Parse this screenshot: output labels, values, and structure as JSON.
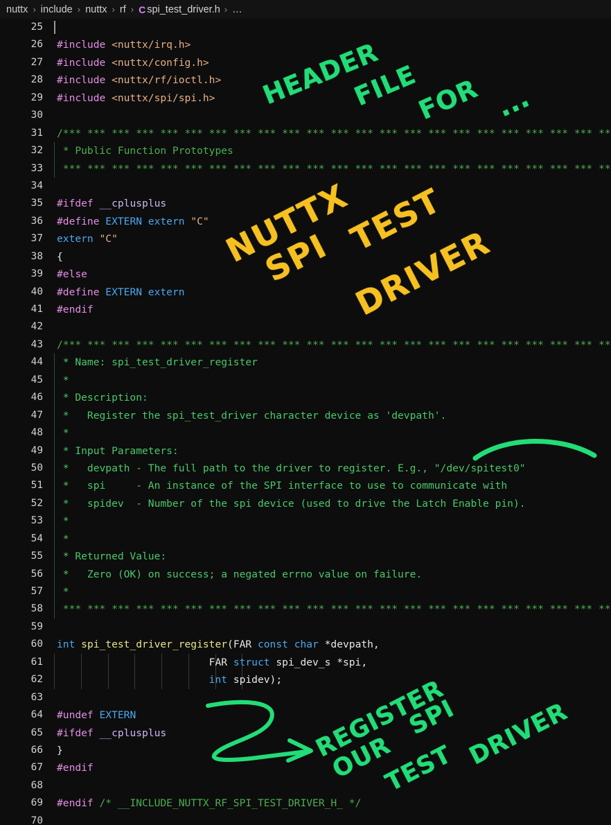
{
  "window": {
    "app": "code-editor",
    "background": "#0d0d0d"
  },
  "breadcrumb": {
    "separator": "›",
    "file_icon_label": "C",
    "items": [
      "nuttx",
      "include",
      "nuttx",
      "rf"
    ],
    "file": "spi_test_driver.h",
    "trailing": "…"
  },
  "colors": {
    "background": "#0d0d0d",
    "breadcrumb_bg": "#131313",
    "line_number": "#d2d2d2",
    "preprocessor": "#e48fe4",
    "string_path": "#e8b086",
    "comment": "#4caf50",
    "comment_body": "#49c96a",
    "identifier": "#c9b9f0",
    "keyword": "#4aa8ef",
    "function": "#e9e58a",
    "plain": "#e8e8e8",
    "annotation_green": "#22dd77",
    "annotation_yellow": "#f6c021"
  },
  "editor": {
    "first_line": 25,
    "last_line": 70,
    "comment_bar": "*** *** *** *** *** *** *** *** *** *** *** *** *** *** *** *** *** *** *** *** *** *** *** *** ***",
    "lines": [
      {
        "n": 25,
        "tokens": []
      },
      {
        "n": 26,
        "tokens": [
          {
            "t": "#include ",
            "c": "t-pre"
          },
          {
            "t": "<nuttx/irq.h>",
            "c": "t-path"
          }
        ]
      },
      {
        "n": 27,
        "tokens": [
          {
            "t": "#include ",
            "c": "t-pre"
          },
          {
            "t": "<nuttx/config.h>",
            "c": "t-path"
          }
        ]
      },
      {
        "n": 28,
        "tokens": [
          {
            "t": "#include ",
            "c": "t-pre"
          },
          {
            "t": "<nuttx/rf/ioctl.h>",
            "c": "t-path"
          }
        ]
      },
      {
        "n": 29,
        "tokens": [
          {
            "t": "#include ",
            "c": "t-pre"
          },
          {
            "t": "<nuttx/spi/spi.h>",
            "c": "t-path"
          }
        ]
      },
      {
        "n": 30,
        "tokens": []
      },
      {
        "n": 31,
        "tokens": [
          {
            "t": "/*** *** *** *** *** *** *** *** *** *** *** *** *** *** *** *** *** *** *** *** *** *** *** *** ****",
            "c": "t-com"
          }
        ]
      },
      {
        "n": 32,
        "tokens": [
          {
            "t": " * Public Function Prototypes",
            "c": "t-com"
          }
        ]
      },
      {
        "n": 33,
        "tokens": [
          {
            "t": " *** *** *** *** *** *** *** *** *** *** *** *** *** *** *** *** *** *** *** *** *** *** *** ***/",
            "c": "t-com"
          }
        ]
      },
      {
        "n": 34,
        "tokens": []
      },
      {
        "n": 35,
        "tokens": [
          {
            "t": "#ifdef ",
            "c": "t-pre"
          },
          {
            "t": "__cplusplus",
            "c": "t-id"
          }
        ]
      },
      {
        "n": 36,
        "tokens": [
          {
            "t": "#define ",
            "c": "t-pre"
          },
          {
            "t": "EXTERN extern ",
            "c": "t-kw"
          },
          {
            "t": "\"C\"",
            "c": "t-path"
          }
        ]
      },
      {
        "n": 37,
        "tokens": [
          {
            "t": "extern ",
            "c": "t-kw"
          },
          {
            "t": "\"C\"",
            "c": "t-path"
          }
        ]
      },
      {
        "n": 38,
        "tokens": [
          {
            "t": "{",
            "c": "t-pl"
          }
        ]
      },
      {
        "n": 39,
        "tokens": [
          {
            "t": "#else",
            "c": "t-pre"
          }
        ]
      },
      {
        "n": 40,
        "tokens": [
          {
            "t": "#define ",
            "c": "t-pre"
          },
          {
            "t": "EXTERN extern",
            "c": "t-kw"
          }
        ]
      },
      {
        "n": 41,
        "tokens": [
          {
            "t": "#endif",
            "c": "t-pre"
          }
        ]
      },
      {
        "n": 42,
        "tokens": []
      },
      {
        "n": 43,
        "tokens": [
          {
            "t": "/*** *** *** *** *** *** *** *** *** *** *** *** *** *** *** *** *** *** *** *** *** *** *** *** ****",
            "c": "t-com"
          }
        ]
      },
      {
        "n": 44,
        "tokens": [
          {
            "t": " * Name: spi_test_driver_register",
            "c": "t-com2"
          }
        ]
      },
      {
        "n": 45,
        "tokens": [
          {
            "t": " *",
            "c": "t-com2"
          }
        ]
      },
      {
        "n": 46,
        "tokens": [
          {
            "t": " * Description:",
            "c": "t-com2"
          }
        ]
      },
      {
        "n": 47,
        "tokens": [
          {
            "t": " *   Register the spi_test_driver character device as 'devpath'.",
            "c": "t-com2"
          }
        ]
      },
      {
        "n": 48,
        "tokens": [
          {
            "t": " *",
            "c": "t-com2"
          }
        ]
      },
      {
        "n": 49,
        "tokens": [
          {
            "t": " * Input Parameters:",
            "c": "t-com2"
          }
        ]
      },
      {
        "n": 50,
        "tokens": [
          {
            "t": " *   devpath - The full path to the driver to register. E.g., \"/dev/spitest0\"",
            "c": "t-com2"
          }
        ]
      },
      {
        "n": 51,
        "tokens": [
          {
            "t": " *   spi     - An instance of the SPI interface to use to communicate with",
            "c": "t-com2"
          }
        ]
      },
      {
        "n": 52,
        "tokens": [
          {
            "t": " *   spidev  - Number of the spi device (used to drive the Latch Enable pin).",
            "c": "t-com2"
          }
        ]
      },
      {
        "n": 53,
        "tokens": [
          {
            "t": " *",
            "c": "t-com2"
          }
        ]
      },
      {
        "n": 54,
        "tokens": [
          {
            "t": " *",
            "c": "t-com2"
          }
        ]
      },
      {
        "n": 55,
        "tokens": [
          {
            "t": " * Returned Value:",
            "c": "t-com2"
          }
        ]
      },
      {
        "n": 56,
        "tokens": [
          {
            "t": " *   Zero (OK) on success; a negated errno value on failure.",
            "c": "t-com2"
          }
        ]
      },
      {
        "n": 57,
        "tokens": [
          {
            "t": " *",
            "c": "t-com2"
          }
        ]
      },
      {
        "n": 58,
        "tokens": [
          {
            "t": " *** *** *** *** *** *** *** *** *** *** *** *** *** *** *** *** *** *** *** *** *** *** *** ***/",
            "c": "t-com"
          }
        ]
      },
      {
        "n": 59,
        "tokens": []
      },
      {
        "n": 60,
        "tokens": [
          {
            "t": "int ",
            "c": "t-kw"
          },
          {
            "t": "spi_test_driver_register",
            "c": "t-fn"
          },
          {
            "t": "(",
            "c": "t-pl"
          },
          {
            "t": "FAR ",
            "c": "t-pl"
          },
          {
            "t": "const char ",
            "c": "t-kw"
          },
          {
            "t": "*devpath,",
            "c": "t-pl"
          }
        ]
      },
      {
        "n": 61,
        "tokens": [
          {
            "t": "                         ",
            "c": "t-pl"
          },
          {
            "t": "FAR ",
            "c": "t-pl"
          },
          {
            "t": "struct ",
            "c": "t-kw"
          },
          {
            "t": "spi_dev_s *spi,",
            "c": "t-pl"
          }
        ]
      },
      {
        "n": 62,
        "tokens": [
          {
            "t": "                         ",
            "c": "t-pl"
          },
          {
            "t": "int ",
            "c": "t-kw"
          },
          {
            "t": "spidev);",
            "c": "t-pl"
          }
        ]
      },
      {
        "n": 63,
        "tokens": []
      },
      {
        "n": 64,
        "tokens": [
          {
            "t": "#undef ",
            "c": "t-pre"
          },
          {
            "t": "EXTERN",
            "c": "t-kw"
          }
        ]
      },
      {
        "n": 65,
        "tokens": [
          {
            "t": "#ifdef ",
            "c": "t-pre"
          },
          {
            "t": "__cplusplus",
            "c": "t-id"
          }
        ]
      },
      {
        "n": 66,
        "tokens": [
          {
            "t": "}",
            "c": "t-pl"
          }
        ]
      },
      {
        "n": 67,
        "tokens": [
          {
            "t": "#endif",
            "c": "t-pre"
          }
        ]
      },
      {
        "n": 68,
        "tokens": []
      },
      {
        "n": 69,
        "tokens": [
          {
            "t": "#endif ",
            "c": "t-pre"
          },
          {
            "t": "/* __INCLUDE_NUTTX_RF_SPI_TEST_DRIVER_H_ */",
            "c": "t-com"
          }
        ]
      },
      {
        "n": 70,
        "tokens": []
      }
    ]
  },
  "annotations": {
    "header_note": {
      "color": "#22dd77",
      "words": [
        "HEADER",
        "FILE",
        "FOR",
        "..."
      ]
    },
    "driver_note": {
      "color": "#f6c021",
      "words": [
        "NUTTX",
        "SPI",
        "TEST",
        "DRIVER"
      ]
    },
    "register_note": {
      "color": "#22dd77",
      "words": [
        "REGISTER",
        "OUR",
        "SPI",
        "TEST",
        "DRIVER"
      ],
      "marker": "z-arrow"
    },
    "underline_arc": {
      "color": "#22dd77",
      "target": "\"/dev/spitest0\""
    }
  }
}
